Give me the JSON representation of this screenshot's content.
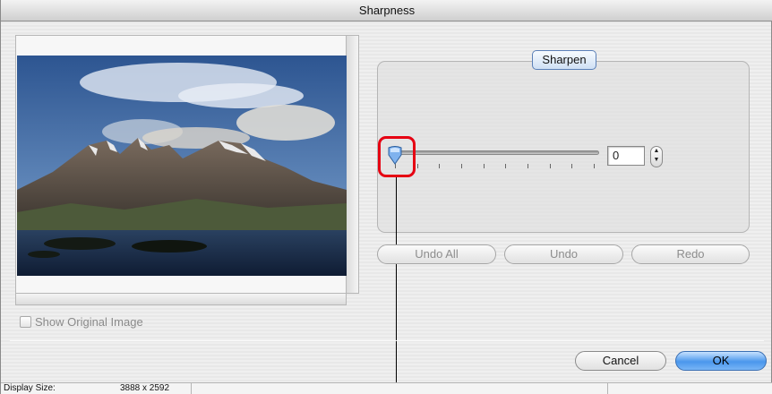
{
  "window": {
    "title": "Sharpness"
  },
  "preview": {
    "show_original_label": "Show Original Image",
    "show_original_checked": false
  },
  "sharpen": {
    "group_label": "Sharpen",
    "slider_value": "0",
    "slider_fraction": 0,
    "tick_count": 10
  },
  "history": {
    "undo_all": "Undo All",
    "undo": "Undo",
    "redo": "Redo"
  },
  "dialog": {
    "cancel": "Cancel",
    "ok": "OK"
  },
  "status": {
    "display_size_label": "Display Size:",
    "display_size_value": "3888 x 2592"
  },
  "colors": {
    "highlight": "#e60012",
    "default_button": "#4a97ec",
    "tab_border": "#5b80b8"
  }
}
